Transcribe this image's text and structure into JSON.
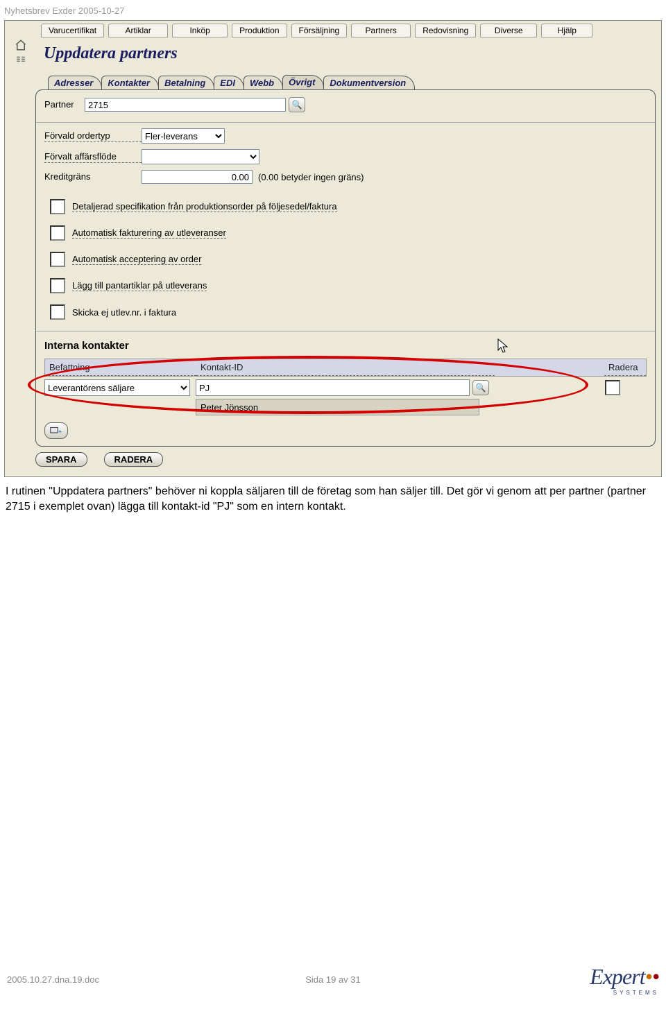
{
  "header_text": "Nyhetsbrev Exder 2005-10-27",
  "menu": [
    "Varucertifikat",
    "Artiklar",
    "Inköp",
    "Produktion",
    "Försäljning",
    "Partners",
    "Redovisning",
    "Diverse",
    "Hjälp"
  ],
  "page_title": "Uppdatera partners",
  "tabs": [
    "Adresser",
    "Kontakter",
    "Betalning",
    "EDI",
    "Webb",
    "Övrigt",
    "Dokumentversion"
  ],
  "active_tab_index": 5,
  "partner_label": "Partner",
  "partner_value": "2715",
  "rows": {
    "ordertyp_label": "Förvald ordertyp",
    "ordertyp_value": "Fler-leverans",
    "affarsflode_label": "Förvalt affärsflöde",
    "affarsflode_value": "",
    "kreditgrans_label": "Kreditgräns",
    "kreditgrans_value": "0.00",
    "kreditgrans_note": "(0.00 betyder ingen gräns)"
  },
  "checkboxes": [
    "Detaljerad specifikation från produktionsorder på följesedel/faktura",
    "Automatisk fakturering av utleveranser",
    "Automatisk acceptering av order",
    "Lägg till pantartiklar på utleverans",
    "Skicka ej utlev.nr. i faktura"
  ],
  "section_title": "Interna kontakter",
  "table": {
    "headers": {
      "befattning": "Befattning",
      "kontakt": "Kontakt-ID",
      "radera": "Radera"
    },
    "row": {
      "befattning": "Leverantörens säljare",
      "kontakt_id": "PJ",
      "kontakt_name": "Peter Jönsson"
    }
  },
  "buttons": {
    "save": "SPARA",
    "delete": "RADERA"
  },
  "body_paragraph": "I rutinen \"Uppdatera partners\" behöver ni koppla säljaren till de företag som han säljer till. Det gör vi genom att per partner (partner 2715 i exemplet ovan) lägga till kontakt-id \"PJ\" som en intern kontakt.",
  "footer": {
    "left": "2005.10.27.dna.19.doc",
    "center": "Sida 19 av 31",
    "logo_text": "Expert",
    "logo_sub": "SYSTEMS"
  }
}
